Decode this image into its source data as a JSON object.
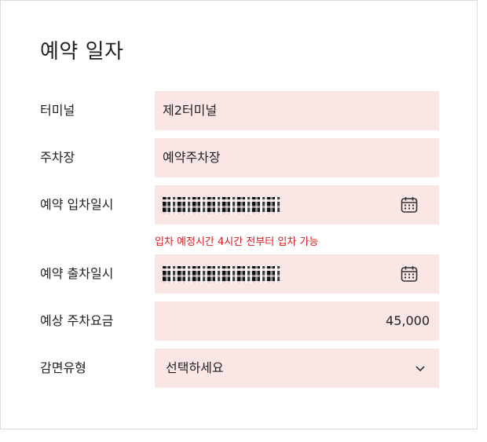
{
  "title": "예약 일자",
  "rows": [
    {
      "label": "터미널",
      "value": "제2터미널"
    },
    {
      "label": "주차장",
      "value": "예약주차장"
    },
    {
      "label": "예약 입차일시",
      "icon": "calendar-icon"
    },
    {
      "label": "예약 출차일시",
      "icon": "calendar-icon"
    },
    {
      "label": "예상 주차요금",
      "value": "45,000"
    },
    {
      "label": "감면유형",
      "value": "선택하세요",
      "icon": "chevron-down-icon"
    }
  ],
  "hint": "입차 예정시간 4시간 전부터 입차 가능",
  "colors": {
    "field_bg": "#fbe6e6",
    "hint": "#d81f1f"
  }
}
